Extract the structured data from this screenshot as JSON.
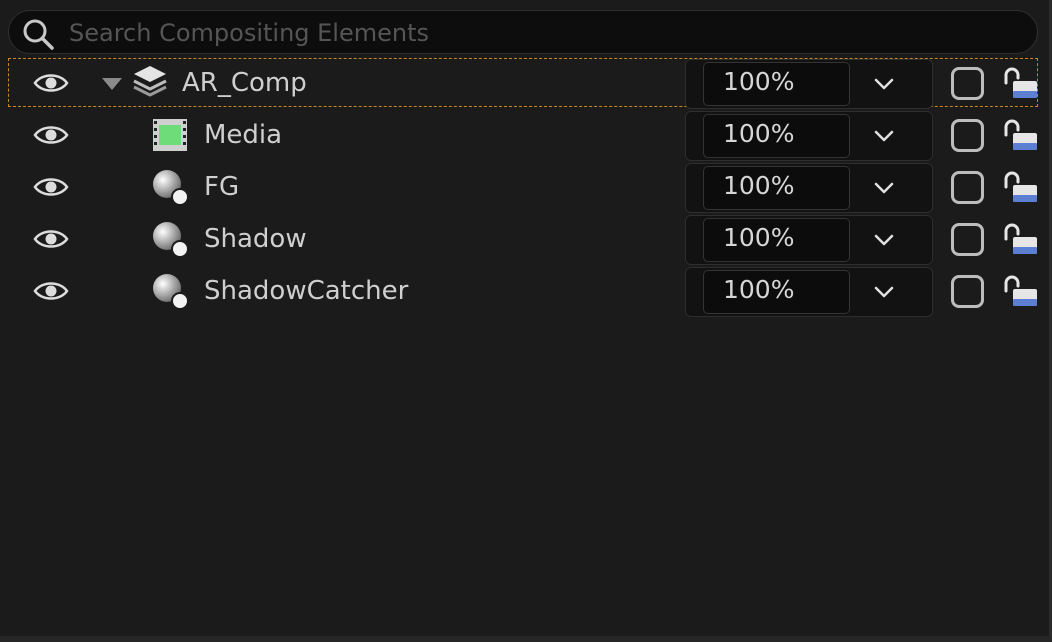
{
  "search": {
    "placeholder": "Search Compositing Elements",
    "value": ""
  },
  "elements": [
    {
      "name": "AR_Comp",
      "icon": "layers-icon",
      "opacity": "100%"
    },
    {
      "name": "Media",
      "icon": "film-strip-icon",
      "opacity": "100%"
    },
    {
      "name": "FG",
      "icon": "sphere-icon",
      "opacity": "100%"
    },
    {
      "name": "Shadow",
      "icon": "sphere-icon",
      "opacity": "100%"
    },
    {
      "name": "ShadowCatcher",
      "icon": "sphere-icon",
      "opacity": "100%"
    }
  ],
  "colors": {
    "background": "#1b1b1b",
    "selection_outline": "#c9871f",
    "text": "#cfcfcf",
    "media_green": "#6fdc7a",
    "lock_blue": "#5c7fd1"
  }
}
